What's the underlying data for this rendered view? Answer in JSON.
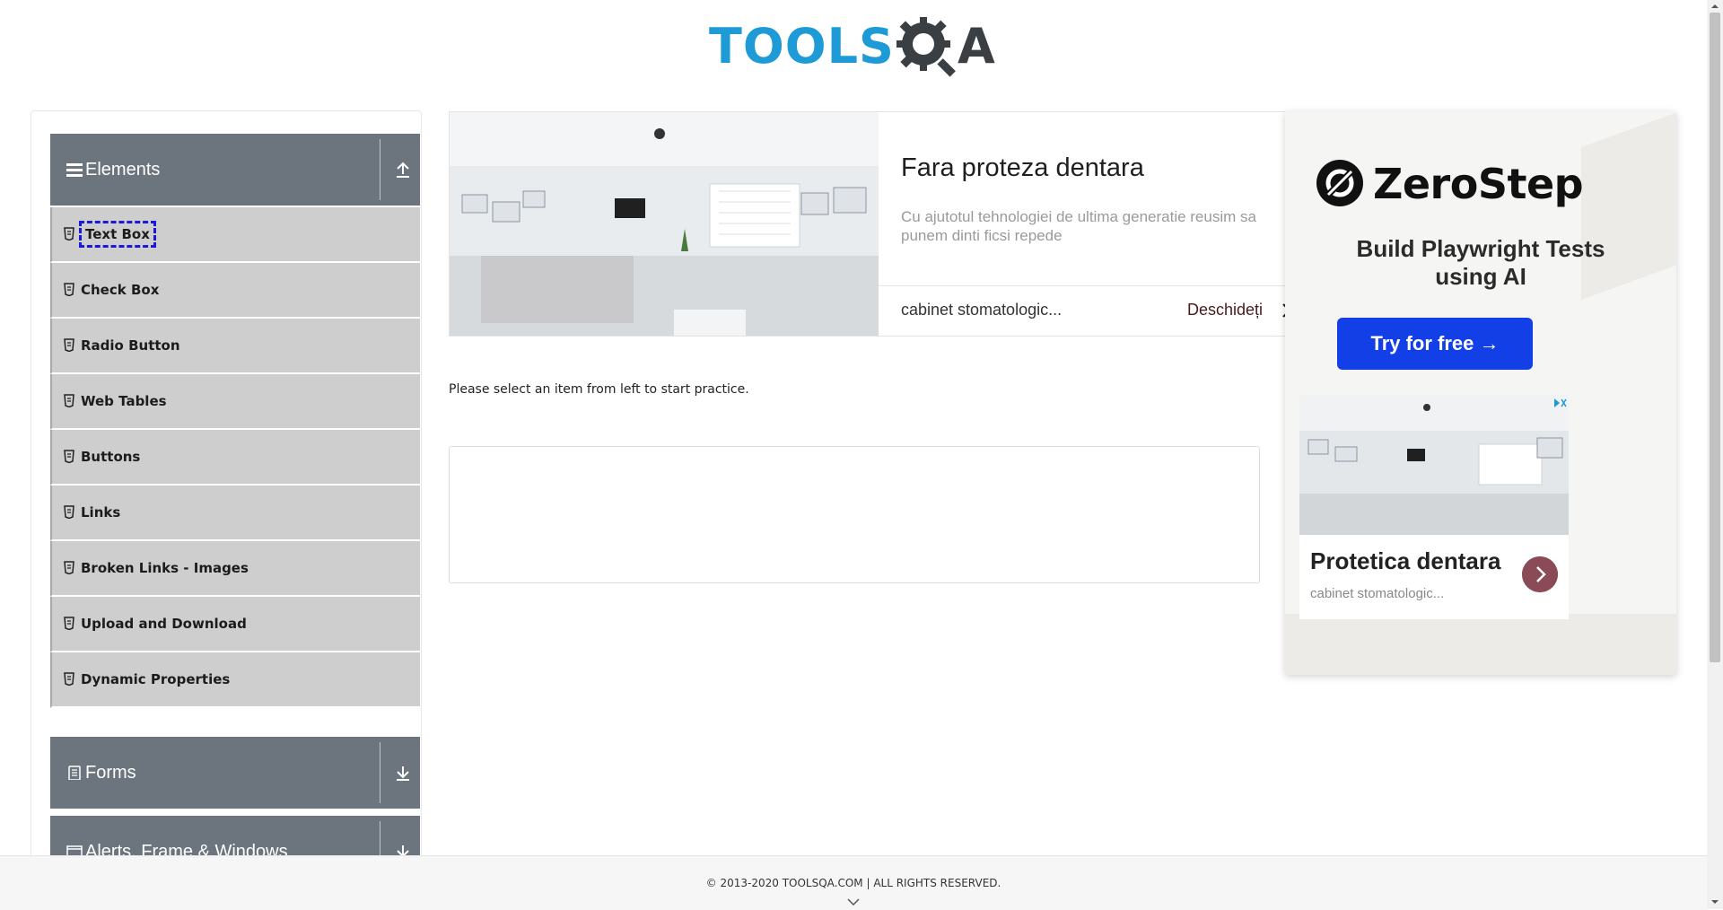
{
  "header": {
    "logo_tools": "TOOLS",
    "logo_qa": "A"
  },
  "sidebar": {
    "groups": [
      {
        "title": "Elements",
        "toggle_icon": "arrow-up-icon"
      },
      {
        "title": "Forms",
        "toggle_icon": "arrow-down-icon"
      },
      {
        "title": "Alerts, Frame & Windows",
        "toggle_icon": "arrow-down-icon"
      }
    ],
    "items": [
      {
        "label": "Text Box"
      },
      {
        "label": "Check Box"
      },
      {
        "label": "Radio Button"
      },
      {
        "label": "Web Tables"
      },
      {
        "label": "Buttons"
      },
      {
        "label": "Links"
      },
      {
        "label": "Broken Links - Images"
      },
      {
        "label": "Upload and Download"
      },
      {
        "label": "Dynamic Properties"
      }
    ]
  },
  "ad_banner": {
    "title": "Fara proteza dentara",
    "description": "Cu ajutotul tehnologiei de ultima generatie reusim sa punem dinti ficsi repede",
    "source": "cabinet stomatologic...",
    "open_label": "Deschideți"
  },
  "main": {
    "instruction": "Please select an item from left to start practice."
  },
  "side_ad": {
    "brand": "ZeroStep",
    "tagline": "Build Playwright Tests using AI",
    "cta": "Try for free →",
    "card_title": "Protetica dentara",
    "card_source": "cabinet stomatologic..."
  },
  "footer": {
    "copyright": "© 2013-2020 TOOLSQA.COM | ALL RIGHTS RESERVED."
  },
  "colors": {
    "group_header": "#6c757d",
    "menu_item": "#cecece",
    "cta": "#1240e6",
    "active_outline": "#1b18d8"
  }
}
